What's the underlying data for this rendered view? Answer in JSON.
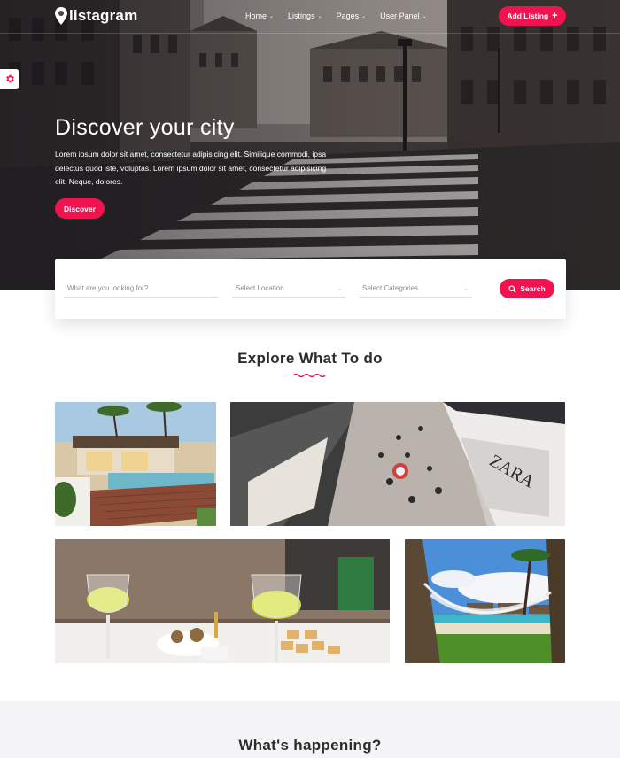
{
  "header": {
    "logo_text": "listagram",
    "nav": [
      {
        "label": "Home"
      },
      {
        "label": "Listings"
      },
      {
        "label": "Pages"
      },
      {
        "label": "User Panel"
      }
    ],
    "add_listing_label": "Add Listing",
    "add_listing_icon": "plus-icon"
  },
  "hero": {
    "title": "Discover your city",
    "text": "Lorem ipsum dolor sit amet, consectetur adipisicing elit. Similique commodi, ipsa delectus quod iste, voluptas. Lorem ipsum dolor sit amet, consectetur adipisicing elit. Neque, dolores.",
    "cta_label": "Discover"
  },
  "search": {
    "keyword_placeholder": "What are you looking for?",
    "location_label": "Select Location",
    "category_label": "Select Categories",
    "button_label": "Search",
    "button_icon": "search-icon"
  },
  "explore": {
    "title": "Explore What To do",
    "tiles": [
      {
        "name": "villa-pool"
      },
      {
        "name": "shopping-street"
      },
      {
        "name": "restaurant-drinks"
      },
      {
        "name": "beach-hammock"
      }
    ]
  },
  "happening": {
    "title": "What's happening?"
  },
  "colors": {
    "accent": "#f1134f",
    "text_dark": "#2c2c2c",
    "band": "#f4f4f6"
  }
}
